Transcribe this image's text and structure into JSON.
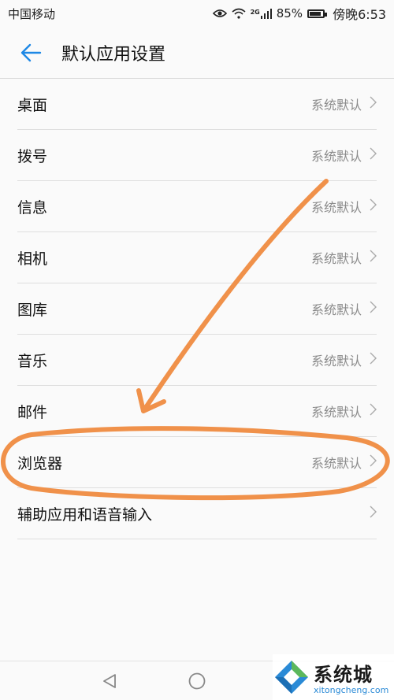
{
  "status_bar": {
    "carrier": "中国移动",
    "network": "2G",
    "battery": "85%",
    "battery_level": 0.85,
    "time": "傍晚6:53"
  },
  "header": {
    "title": "默认应用设置"
  },
  "list": [
    {
      "label": "桌面",
      "value": "系统默认"
    },
    {
      "label": "拨号",
      "value": "系统默认"
    },
    {
      "label": "信息",
      "value": "系统默认"
    },
    {
      "label": "相机",
      "value": "系统默认"
    },
    {
      "label": "图库",
      "value": "系统默认"
    },
    {
      "label": "音乐",
      "value": "系统默认"
    },
    {
      "label": "邮件",
      "value": "系统默认"
    },
    {
      "label": "浏览器",
      "value": "系统默认"
    },
    {
      "label": "辅助应用和语音输入",
      "value": ""
    }
  ],
  "watermark": {
    "title": "系统城",
    "url": "xitongcheng.com"
  },
  "colors": {
    "accent": "#1e88e5",
    "annotation": "#f0914a",
    "value_text": "#8a8a8a"
  }
}
